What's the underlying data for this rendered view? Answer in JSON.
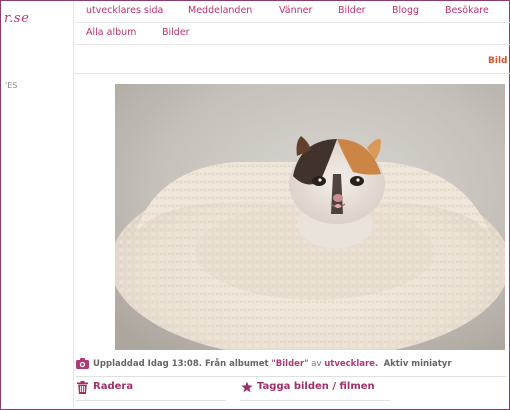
{
  "brand": {
    "logo_text": "r.se"
  },
  "sidebar": {
    "snippet": "'ES"
  },
  "nav": {
    "items": [
      {
        "label": "utvecklares sida"
      },
      {
        "label": "Meddelanden"
      },
      {
        "label": "Vänner"
      },
      {
        "label": "Bilder"
      },
      {
        "label": "Blogg"
      },
      {
        "label": "Besökare"
      }
    ]
  },
  "subnav": {
    "items": [
      {
        "label": "Alla album"
      },
      {
        "label": "Bilder"
      }
    ]
  },
  "content": {
    "right_label": "Bild"
  },
  "photo": {
    "subject": "calico kitten in fleece pet bed"
  },
  "meta": {
    "uploaded_text": "Uppladdad Idag 13:08. Från albumet",
    "album_name": "\"Bilder\"",
    "by_word": "av",
    "user": "utvecklare.",
    "active_thumb": "Aktiv miniatyr"
  },
  "actions": {
    "delete_label": "Radera",
    "tag_label": "Tagga bilden / filmen"
  },
  "colors": {
    "accent": "#c0306b",
    "border": "#8b3d6b"
  }
}
